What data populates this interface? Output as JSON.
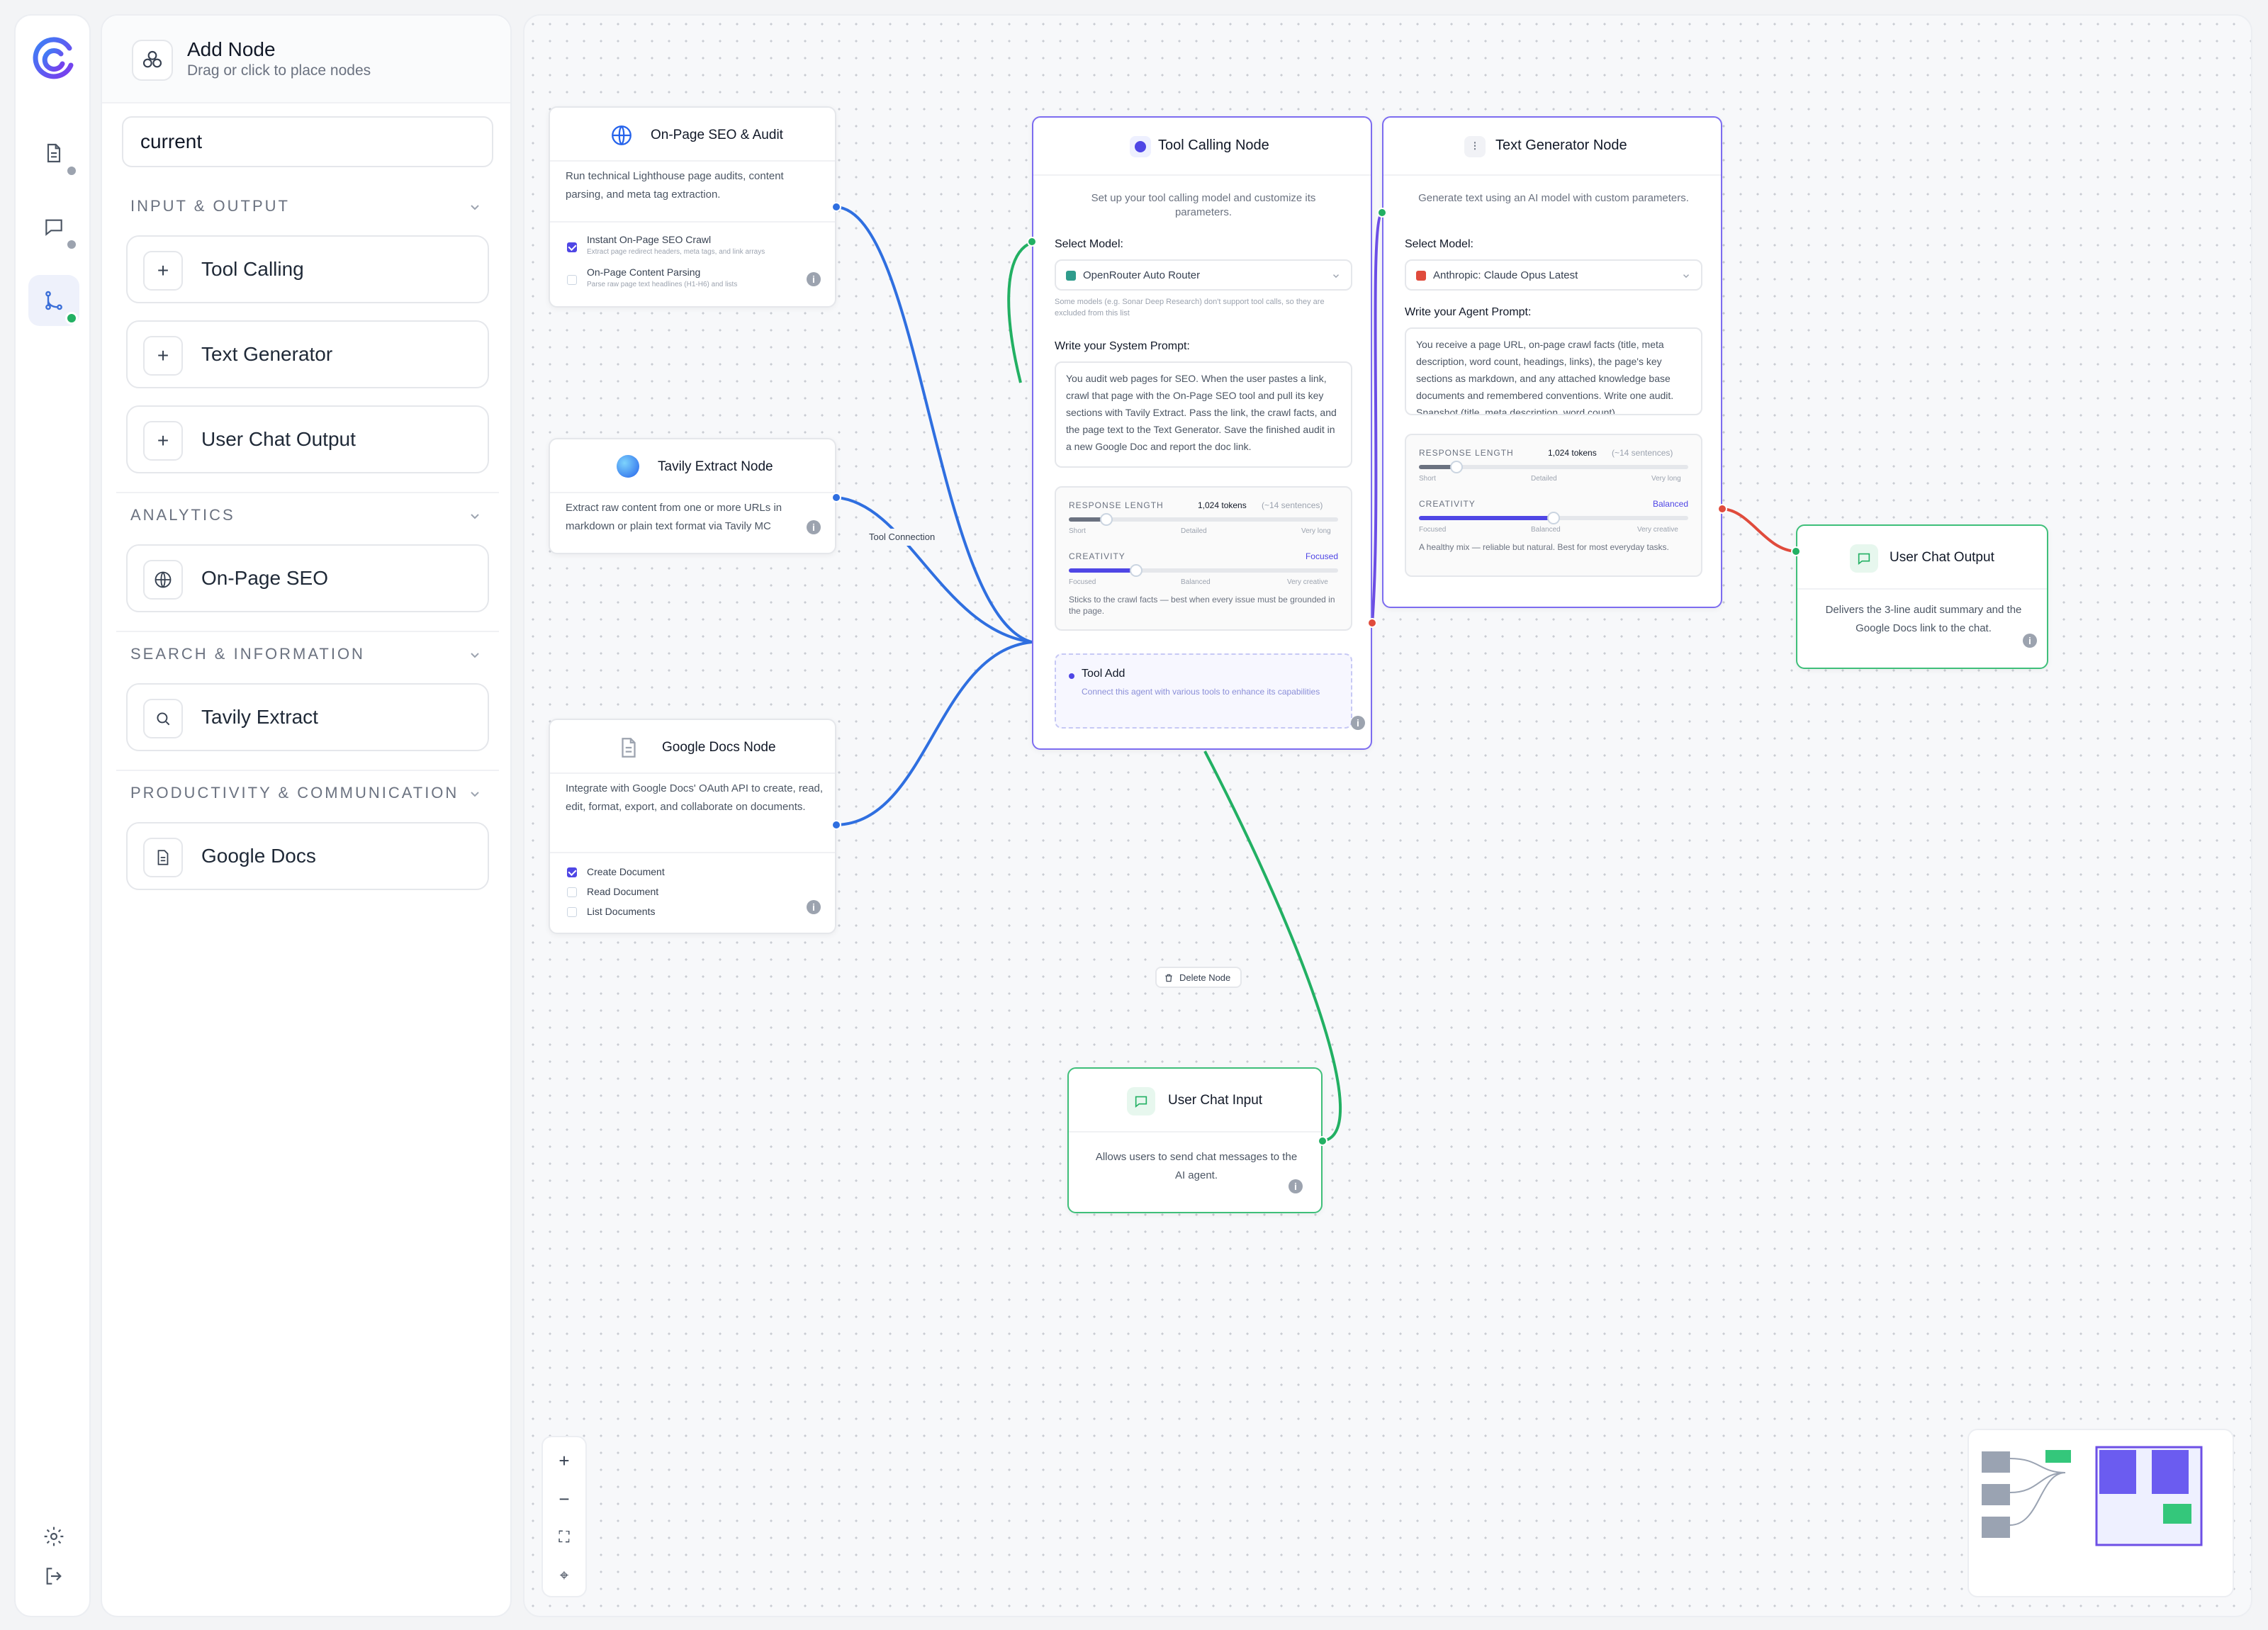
{
  "colors": {
    "blue_edge": "#2f6fe0",
    "green_edge": "#22b063",
    "red_edge": "#e04b3c",
    "purple_edge": "#6d4fe6",
    "accent": "#4f46e5",
    "green_node_border": "#3fbf7a"
  },
  "rail": {
    "items": [
      {
        "icon": "document-icon"
      },
      {
        "icon": "chat-icon"
      },
      {
        "icon": "workflow-icon"
      }
    ],
    "bottom": [
      {
        "icon": "gear-icon"
      },
      {
        "icon": "logout-icon"
      }
    ]
  },
  "panel": {
    "title": "Add Node",
    "subtitle": "Drag or click to place nodes",
    "search_value": "current",
    "sections": [
      {
        "title": "INPUT & OUTPUT",
        "items": [
          {
            "label": "Tool Calling",
            "icon": "plus-icon"
          },
          {
            "label": "Text Generator",
            "icon": "plus-icon"
          },
          {
            "label": "User Chat Output",
            "icon": "plus-icon"
          }
        ]
      },
      {
        "title": "ANALYTICS",
        "items": [
          {
            "label": "On-Page SEO",
            "icon": "globe-icon"
          }
        ]
      },
      {
        "title": "SEARCH & INFORMATION",
        "items": [
          {
            "label": "Tavily Extract",
            "icon": "search-icon"
          }
        ]
      },
      {
        "title": "PRODUCTIVITY & COMMUNICATION",
        "items": [
          {
            "label": "Google Docs",
            "icon": "document-icon"
          }
        ]
      }
    ]
  },
  "nodes": {
    "seo": {
      "title": "On-Page SEO & Audit",
      "desc": "Run technical Lighthouse page audits, content parsing, and meta tag extraction.",
      "options": [
        {
          "label": "Instant On-Page SEO Crawl",
          "sub": "Extract page redirect headers, meta tags, and link arrays",
          "checked": true
        },
        {
          "label": "On-Page Content Parsing",
          "sub": "Parse raw page text headlines (H1-H6) and lists",
          "checked": false
        }
      ]
    },
    "tavily": {
      "title": "Tavily Extract Node",
      "desc": "Extract raw content from one or more URLs in markdown or plain text format via Tavily MC"
    },
    "gdocs": {
      "title": "Google Docs Node",
      "desc": "Integrate with Google Docs' OAuth API to create, read, edit, format, export, and collaborate on documents.",
      "options": [
        {
          "label": "Create Document",
          "checked": true
        },
        {
          "label": "Read Document",
          "checked": false
        },
        {
          "label": "List Documents",
          "checked": false
        }
      ]
    },
    "tool_calling": {
      "title": "Tool Calling Node",
      "desc": "Set up your tool calling model and customize its parameters.",
      "model_label": "Select Model:",
      "model": "OpenRouter Auto Router",
      "model_note": "Some models (e.g. Sonar Deep Research) don't support tool calls, so they are excluded from this list",
      "prompt_label": "Write your System Prompt:",
      "prompt": "You audit web pages for SEO. When the user pastes a link, crawl that page with the On-Page SEO tool and pull its key sections with Tavily Extract. Pass the link, the crawl facts, and the page text to the Text Generator. Save the finished audit in a new Google Doc and report the doc link.",
      "response_length_label": "RESPONSE LENGTH",
      "response_length_value": "1,024 tokens",
      "response_length_note": "(~14 sentences)",
      "response_length_fraction": 0.14,
      "length_ticks": [
        "Short",
        "Detailed",
        "Very long"
      ],
      "creativity_label": "CREATIVITY",
      "creativity_value": "Focused",
      "creativity_fraction": 0.25,
      "creativity_ticks": [
        "Focused",
        "Balanced",
        "Very creative"
      ],
      "creativity_note": "Sticks to the crawl facts — best when every issue must be grounded in the page.",
      "tool_add_title": "Tool Add",
      "tool_add_desc": "Connect this agent with various tools to enhance its capabilities"
    },
    "text_gen": {
      "title": "Text Generator Node",
      "desc": "Generate text using an AI model with custom parameters.",
      "model_label": "Select Model:",
      "model": "Anthropic: Claude Opus Latest",
      "prompt_label": "Write your Agent Prompt:",
      "prompt": "You receive a page URL, on-page crawl facts (title, meta description, word count, headings, links), the page's key sections as markdown, and any attached knowledge base documents and remembered conventions. Write one audit. Snapshot (title, meta description, word count)",
      "response_length_label": "RESPONSE LENGTH",
      "response_length_value": "1,024 tokens",
      "response_length_note": "(~14 sentences)",
      "response_length_fraction": 0.14,
      "length_ticks": [
        "Short",
        "Detailed",
        "Very long"
      ],
      "creativity_label": "CREATIVITY",
      "creativity_value": "Balanced",
      "creativity_fraction": 0.5,
      "creativity_ticks": [
        "Focused",
        "Balanced",
        "Very creative"
      ],
      "creativity_note": "A healthy mix — reliable but natural. Best for most everyday tasks."
    },
    "chat_output": {
      "title": "User Chat Output",
      "desc": "Delivers the 3-line audit summary and the Google Docs link to the chat."
    },
    "chat_input": {
      "title": "User Chat Input",
      "desc": "Allows users to send chat messages to the AI agent."
    }
  },
  "canvas": {
    "edge_label": "Tool Connection",
    "delete_node": "Delete Node",
    "controls": [
      {
        "label": "+",
        "name": "zoom-in-button"
      },
      {
        "label": "−",
        "name": "zoom-out-button"
      },
      {
        "label": "⛶",
        "name": "fit-view-button"
      },
      {
        "label": "⌖",
        "name": "lock-button"
      }
    ]
  }
}
